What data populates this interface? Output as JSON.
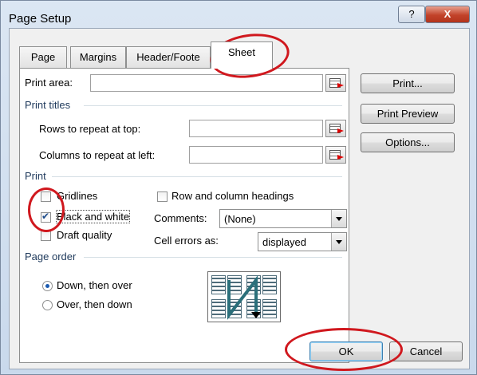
{
  "window": {
    "title": "Page Setup",
    "help_label": "?",
    "close_label": "X"
  },
  "tabs": [
    {
      "label": "Page"
    },
    {
      "label": "Margins"
    },
    {
      "label": "Header/Foote"
    },
    {
      "label": "Sheet"
    }
  ],
  "sheet": {
    "print_area_label": "Print area:",
    "print_area_value": "",
    "print_titles_label": "Print titles",
    "rows_label": "Rows to repeat at top:",
    "rows_value": "",
    "columns_label": "Columns to repeat at left:",
    "columns_value": "",
    "print_label": "Print",
    "gridlines_label": "Gridlines",
    "gridlines_checked": false,
    "black_white_label": "Black and white",
    "black_white_checked": true,
    "draft_label": "Draft quality",
    "draft_checked": false,
    "row_col_headings_label": "Row and column headings",
    "row_col_headings_checked": false,
    "comments_label": "Comments:",
    "comments_value": "(None)",
    "cell_errors_label": "Cell errors as:",
    "cell_errors_value": "displayed",
    "page_order_label": "Page order",
    "down_over_label": "Down, then over",
    "over_down_label": "Over, then down",
    "selected_order": "Down, then over"
  },
  "side_buttons": {
    "print": "Print...",
    "print_preview": "Print Preview",
    "options": "Options..."
  },
  "footer": {
    "ok": "OK",
    "cancel": "Cancel"
  },
  "icons": [
    "range-picker-icon",
    "page-order-preview-icon"
  ],
  "colors": {
    "annotation_red": "#d0181e",
    "accent": "#1c5bb0"
  }
}
